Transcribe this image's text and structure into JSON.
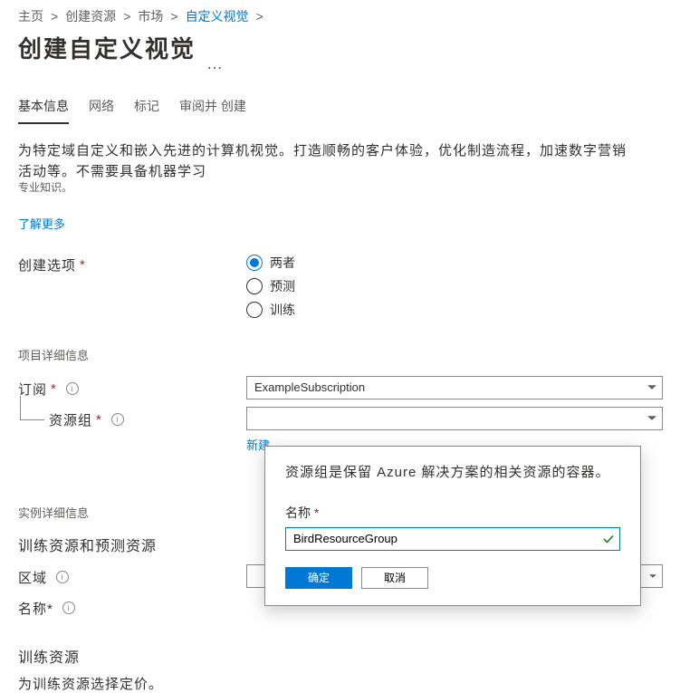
{
  "breadcrumb": {
    "home": "主页",
    "create_resource": "创建资源",
    "marketplace": "市场",
    "custom_vision": "自定义视觉"
  },
  "page_title": "创建自定义视觉",
  "tabs": {
    "basic": "基本信息",
    "network": "网络",
    "tags": "标记",
    "review": "审阅并 创建"
  },
  "description": "为特定域自定义和嵌入先进的计算机视觉。打造顺畅的客户体验，优化制造流程，加速数字营销活动等。不需要具备机器学习",
  "subnote": "专业知识。",
  "learn_more": "了解更多",
  "create_options": {
    "label": "创建选项",
    "both": "两者",
    "predict": "预测",
    "train": "训练"
  },
  "sections": {
    "project_details": "项目详细信息",
    "instance_details": "实例详细信息",
    "train_predict_title": "训练资源和预测资源",
    "train_resource_title": "训练资源",
    "train_resource_sub": "为训练资源选择定价。"
  },
  "fields": {
    "subscription_label": "订阅",
    "subscription_value": "ExampleSubscription",
    "resource_group_label": "资源组",
    "resource_group_value": "",
    "create_new": "新建",
    "region_label": "区域",
    "name_label": "名称*"
  },
  "flyout": {
    "description": "资源组是保留 Azure 解决方案的相关资源的容器。",
    "name_label": "名称",
    "name_value": "BirdResourceGroup",
    "ok": "确定",
    "cancel": "取消"
  }
}
